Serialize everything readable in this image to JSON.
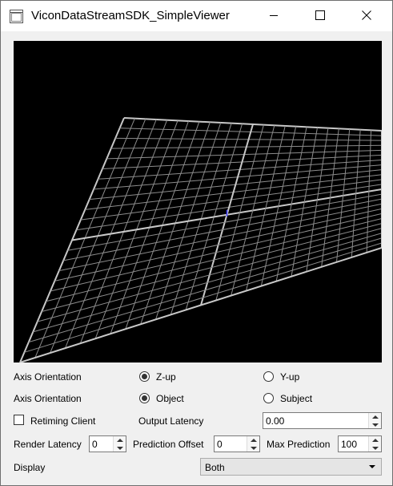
{
  "window": {
    "title": "ViconDataStreamSDK_SimpleViewer"
  },
  "controls": {
    "axis_row": {
      "label": "Axis Orientation",
      "option_a": "Z-up",
      "option_b": "Y-up",
      "selected": "Z-up"
    },
    "object_row": {
      "label": "Axis Orientation",
      "option_a": "Object",
      "option_b": "Subject",
      "selected": "Object"
    },
    "retiming": {
      "label": "Retiming Client",
      "checked": false
    },
    "output_latency": {
      "label": "Output Latency",
      "value": "0.00"
    },
    "render_latency": {
      "label": "Render Latency",
      "value": "0"
    },
    "prediction_offset": {
      "label": "Prediction Offset",
      "value": "0"
    },
    "max_prediction": {
      "label": "Max Prediction",
      "value": "100"
    },
    "display": {
      "label": "Display",
      "value": "Both"
    }
  },
  "colors": {
    "viewport_bg": "#000000",
    "grid_line": "#8c8c8c",
    "grid_axis": "#c8c8c8",
    "window_bg": "#f0f0f0"
  },
  "icons": {
    "app": "app-icon",
    "minimize": "minimize-icon",
    "maximize": "maximize-icon",
    "close": "close-icon"
  }
}
